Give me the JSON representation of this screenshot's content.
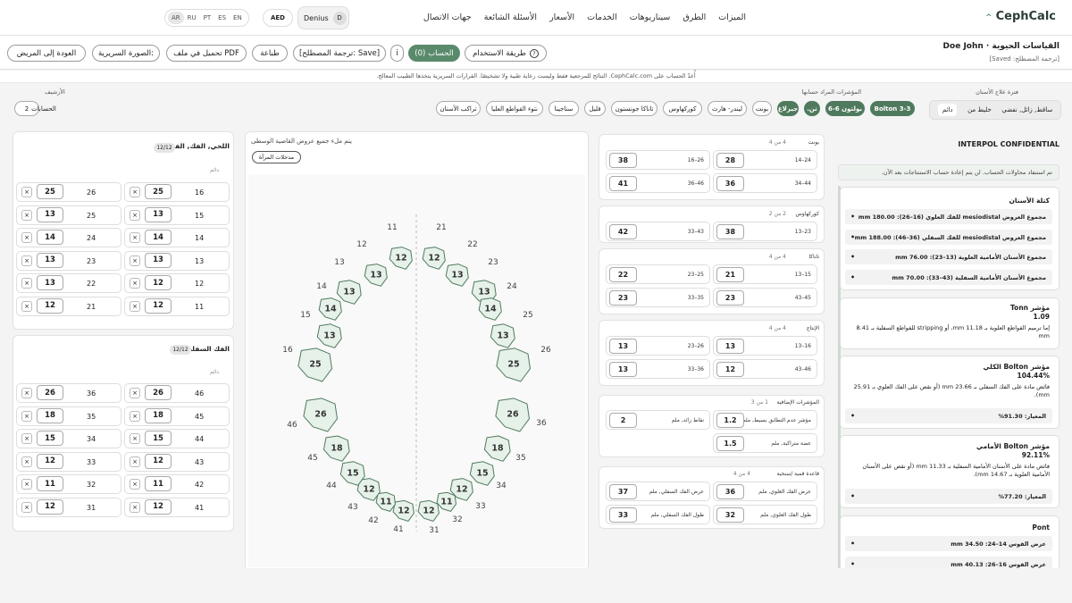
{
  "nav": {
    "brand": "CephCalc",
    "menu": [
      "الميزات",
      "الطرق",
      "سيناريوهات",
      "الخدمات",
      "الأسعار",
      "الأسئلة الشائعة",
      "جهات الاتصال"
    ],
    "langs": [
      "AR",
      "RU",
      "PT",
      "ES",
      "EN"
    ],
    "currency": "AED",
    "user": "Denius",
    "user_initial": "D",
    "caret": "^"
  },
  "header": {
    "title": "القياسات الحيوية · Doe John",
    "subtitle": "[ترجمة المصطلح: Saved]"
  },
  "toolbar": {
    "back": "العودة إلى المريض",
    "xray": "الصورة السريرية:",
    "pdf": "تحميل في ملف PDF",
    "print": "طباعة",
    "save": "[ترجمة المصطلح: Save]",
    "info": "i",
    "calc": "الحساب (0)",
    "usage": "طريقة الاستخدام",
    "usage_icon": "?"
  },
  "disclaimer": "أُعدّ الحساب على CephCalc.com. النتائج للمرجعية فقط وليست رعاية طبية ولا تشخيصًا. القرارات السريرية يتخذها الطبيب المعالج.",
  "controls": {
    "arch_label": "فترة علاج الأسنان",
    "arch_opts": [
      "دائم",
      "خليط من",
      "ساقط, زائل, نفضي"
    ],
    "index_label": "المؤشرات المراد حسابها",
    "chips_row1": [
      "Bolton 3-3",
      "بولتون 6-6",
      "تن.",
      "جيرلاغ",
      "بونت",
      "ليندر- هارث",
      "كوركهاوس",
      "تاناكا جونستون",
      "فليل",
      "سناجينا",
      "نتوء القواطع العليا",
      "تراكب الأسنان"
    ],
    "archive_label": "الأرشيف",
    "archive_btn": "الحسابات",
    "archive_count": "2"
  },
  "upper": {
    "title": "اللحي, الفك, الفقم",
    "badge": "12/12",
    "state": "دائم",
    "rows": [
      [
        "16",
        "25",
        "26",
        "25"
      ],
      [
        "15",
        "13",
        "25",
        "13"
      ],
      [
        "14",
        "14",
        "24",
        "14"
      ],
      [
        "13",
        "13",
        "23",
        "13"
      ],
      [
        "12",
        "12",
        "22",
        "13"
      ],
      [
        "11",
        "12",
        "21",
        "12"
      ]
    ]
  },
  "lower": {
    "title": "الفك السفلي",
    "badge": "12/12",
    "state": "دائم",
    "rows": [
      [
        "46",
        "26",
        "36",
        "26"
      ],
      [
        "45",
        "18",
        "35",
        "18"
      ],
      [
        "44",
        "15",
        "34",
        "15"
      ],
      [
        "43",
        "12",
        "33",
        "12"
      ],
      [
        "42",
        "11",
        "32",
        "11"
      ],
      [
        "41",
        "12",
        "31",
        "12"
      ]
    ]
  },
  "diagram": {
    "title": "يتم ملء جميع عروض القاصية الوسطى",
    "mirror": "مدخلات المرآة",
    "left_nums": [
      "11",
      "12",
      "13",
      "14",
      "15",
      "16"
    ],
    "right_nums": [
      "21",
      "22",
      "23",
      "24",
      "25",
      "26"
    ],
    "left_low": [
      "46",
      "45",
      "44",
      "43",
      "42",
      "41"
    ],
    "right_low": [
      "36",
      "35",
      "34",
      "33",
      "32",
      "31"
    ],
    "vals": {
      "11": "12",
      "12": "13",
      "13": "13",
      "14": "14",
      "15": "13",
      "16": "25",
      "21": "12",
      "22": "13",
      "23": "13",
      "24": "14",
      "25": "13",
      "26": "25",
      "46": "26",
      "45": "18",
      "44": "15",
      "43": "12",
      "42": "11",
      "41": "12",
      "36": "26",
      "35": "18",
      "34": "15",
      "33": "12",
      "32": "11",
      "31": "12"
    }
  },
  "groups": [
    {
      "name": "بونت",
      "count": "4 من 4",
      "rows": [
        [
          "14–24",
          "28",
          "16–26",
          "38"
        ],
        [
          "34–44",
          "36",
          "36–46",
          "41"
        ]
      ]
    },
    {
      "name": "كوركهاوس",
      "count": "2 من 2",
      "rows": [
        [
          "13–23",
          "38",
          "33–43",
          "42"
        ]
      ]
    },
    {
      "name": "تاناكا",
      "count": "4 من 4",
      "rows": [
        [
          "13–15",
          "21",
          "23–25",
          "22"
        ],
        [
          "43–45",
          "23",
          "33–35",
          "23"
        ]
      ]
    },
    {
      "name": "الإنتاج",
      "count": "4 من 4",
      "rows": [
        [
          "13–16",
          "13",
          "23–26",
          "13"
        ],
        [
          "43–46",
          "12",
          "33–36",
          "13"
        ]
      ]
    }
  ],
  "extra": {
    "title": "المؤشرات الإضافية",
    "count": "1 من 3",
    "r1a": "مؤشر عدم التطابق بسيط, ملم",
    "r1b": "1.2",
    "r1c": "نقاط زائد, ملم",
    "r1d": "2",
    "r2a": "عضة متراكبة, ملم",
    "r2b": "1.5"
  },
  "base": {
    "title": "قاعدة قمية /سنخية",
    "count": "4 من 4",
    "rows": [
      [
        "عرض الفك العلوي, ملم",
        "36",
        "عرض الفك السفلي, ملم",
        "37"
      ],
      [
        "طول الفك العلوي, ملم",
        "32",
        "طول الفك السفلي, ملم",
        "33"
      ]
    ]
  },
  "results": {
    "confidential": "INTERPOL CONFIDENTIAL",
    "notice": "تم استنفاد محاولات الحساب. لن يتم إعادة حساب الاستنتاجات بعد الآن.",
    "mass_title": "كتلة الأسنان",
    "mass": [
      "مجموع العروض mesiodistal للفك العلوي (16–26): 180.00 mm",
      "مجموع العروض mesiodistal للفك السفلي (36–46): 188.00 mm",
      "مجموع الأسنان الأمامية العلوية (13–23): 76.00 mm",
      "مجموع الأسنان الأمامية السفلية (43–33): 70.00 mm"
    ],
    "tonn_title": "مؤشر Tonn",
    "tonn_val": "1.09",
    "tonn_text": "إما ترميم القواطع العلوية بـ 11.18 mm، أو stripping للقواطع السفلية بـ 8.41 mm",
    "bt_title": "مؤشر Bolton الكلي",
    "bt_val": "104.44%",
    "bt_text": "فائض مادة على الفك السفلي بـ 23.66 mm (أو نقص على الفك العلوي بـ 25.91 mm).",
    "bt_norm": "المعيار: 91.30%",
    "ba_title": "مؤشر Bolton الأمامي",
    "ba_val": "92.11%",
    "ba_text": "فائض مادة على الأسنان الأمامية السفلية بـ 11.33 mm (أو نقص على الأسنان الأمامية العلوية بـ 14.67 mm).",
    "ba_norm": "المعيار: 77.20%",
    "pont_title": "Pont",
    "pont": [
      "عرض القوس 14–24: 34.50 mm",
      "عرض القوس 16–26: 40.13 mm"
    ]
  }
}
